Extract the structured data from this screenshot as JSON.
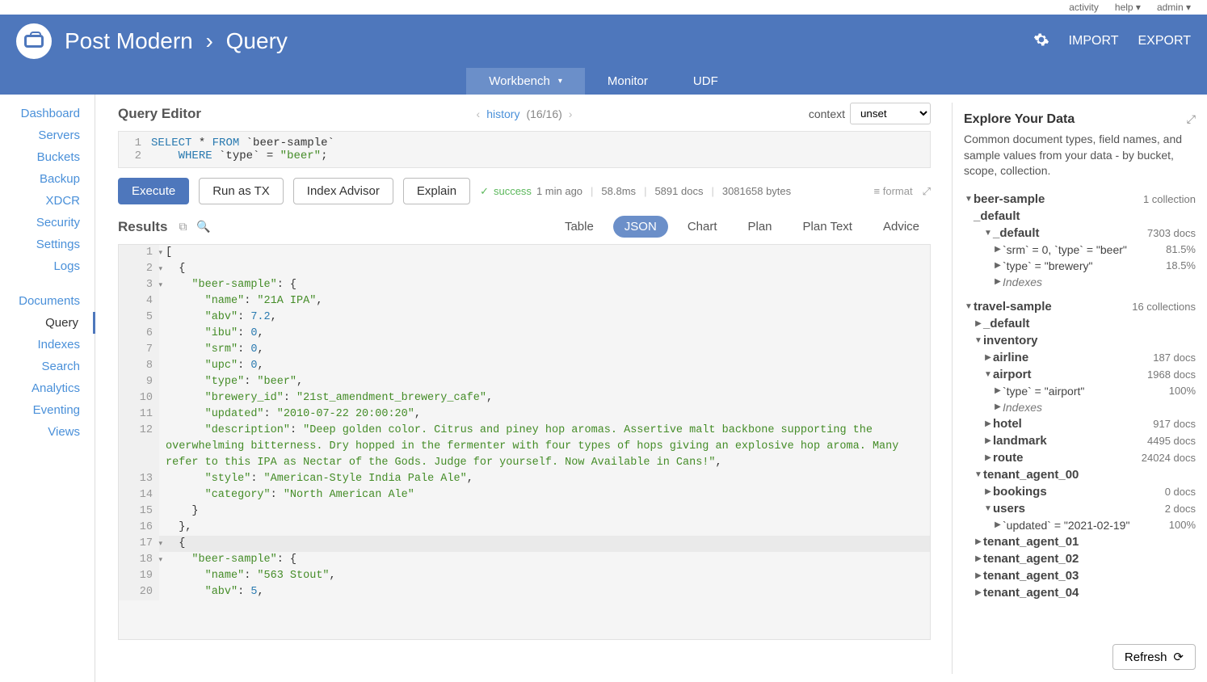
{
  "topbar": {
    "activity": "activity",
    "help": "help",
    "admin": "admin"
  },
  "header": {
    "brand": "Post Modern",
    "section": "Query",
    "import": "IMPORT",
    "export": "EXPORT"
  },
  "tabs": {
    "workbench": "Workbench",
    "monitor": "Monitor",
    "udf": "UDF"
  },
  "sidebar": {
    "dashboard": "Dashboard",
    "servers": "Servers",
    "buckets": "Buckets",
    "backup": "Backup",
    "xdcr": "XDCR",
    "security": "Security",
    "settings": "Settings",
    "logs": "Logs",
    "documents": "Documents",
    "query": "Query",
    "indexes": "Indexes",
    "search": "Search",
    "analytics": "Analytics",
    "eventing": "Eventing",
    "views": "Views"
  },
  "editor": {
    "title": "Query Editor",
    "history_label": "history",
    "history_count": "(16/16)",
    "context_label": "context",
    "context_value": "unset",
    "line1": "SELECT * FROM `beer-sample`",
    "line2": "    WHERE `type` = \"beer\";"
  },
  "actions": {
    "execute": "Execute",
    "run_as_tx": "Run as TX",
    "index_advisor": "Index Advisor",
    "explain": "Explain"
  },
  "status": {
    "success": "success",
    "time_ago": "1 min ago",
    "elapsed": "58.8ms",
    "docs": "5891 docs",
    "bytes": "3081658 bytes",
    "format": "format"
  },
  "results": {
    "title": "Results",
    "tabs": {
      "table": "Table",
      "json": "JSON",
      "chart": "Chart",
      "plan": "Plan",
      "plan_text": "Plan Text",
      "advice": "Advice"
    }
  },
  "json_output": {
    "l1": "[",
    "l2": "  {",
    "l3": "    \"beer-sample\": {",
    "l4": "      \"name\": \"21A IPA\",",
    "l5": "      \"abv\": 7.2,",
    "l6": "      \"ibu\": 0,",
    "l7": "      \"srm\": 0,",
    "l8": "      \"upc\": 0,",
    "l9": "      \"type\": \"beer\",",
    "l10": "      \"brewery_id\": \"21st_amendment_brewery_cafe\",",
    "l11": "      \"updated\": \"2010-07-22 20:00:20\",",
    "l12": "      \"description\": \"Deep golden color. Citrus and piney hop aromas. Assertive malt backbone supporting the overwhelming bitterness. Dry hopped in the fermenter with four types of hops giving an explosive hop aroma. Many refer to this IPA as Nectar of the Gods. Judge for yourself. Now Available in Cans!\",",
    "l13": "      \"style\": \"American-Style India Pale Ale\",",
    "l14": "      \"category\": \"North American Ale\"",
    "l15": "    }",
    "l16": "  },",
    "l17": "  {",
    "l18": "    \"beer-sample\": {",
    "l19": "      \"name\": \"563 Stout\",",
    "l20": "      \"abv\": 5,"
  },
  "right": {
    "title": "Explore Your Data",
    "desc": "Common document types, field names, and sample values from your data - by bucket, scope, collection.",
    "beer_sample": "beer-sample",
    "beer_sample_meta": "1 collection",
    "default_scope": "_default",
    "default_coll": "_default",
    "default_coll_meta": "7303 docs",
    "srm_flavor": "`srm` = 0, `type` = \"beer\"",
    "srm_pct": "81.5%",
    "brewery_flavor": "`type` = \"brewery\"",
    "brewery_pct": "18.5%",
    "indexes": "Indexes",
    "travel_sample": "travel-sample",
    "travel_sample_meta": "16 collections",
    "ts_default": "_default",
    "inventory": "inventory",
    "airline": "airline",
    "airline_meta": "187 docs",
    "airport": "airport",
    "airport_meta": "1968 docs",
    "airport_flavor": "`type` = \"airport\"",
    "airport_pct": "100%",
    "hotel": "hotel",
    "hotel_meta": "917 docs",
    "landmark": "landmark",
    "landmark_meta": "4495 docs",
    "route": "route",
    "route_meta": "24024 docs",
    "tenant0": "tenant_agent_00",
    "bookings": "bookings",
    "bookings_meta": "0 docs",
    "users": "users",
    "users_meta": "2 docs",
    "users_flavor": "`updated` = \"2021-02-19\"",
    "users_pct": "100%",
    "tenant1": "tenant_agent_01",
    "tenant2": "tenant_agent_02",
    "tenant3": "tenant_agent_03",
    "tenant4": "tenant_agent_04",
    "refresh": "Refresh"
  }
}
